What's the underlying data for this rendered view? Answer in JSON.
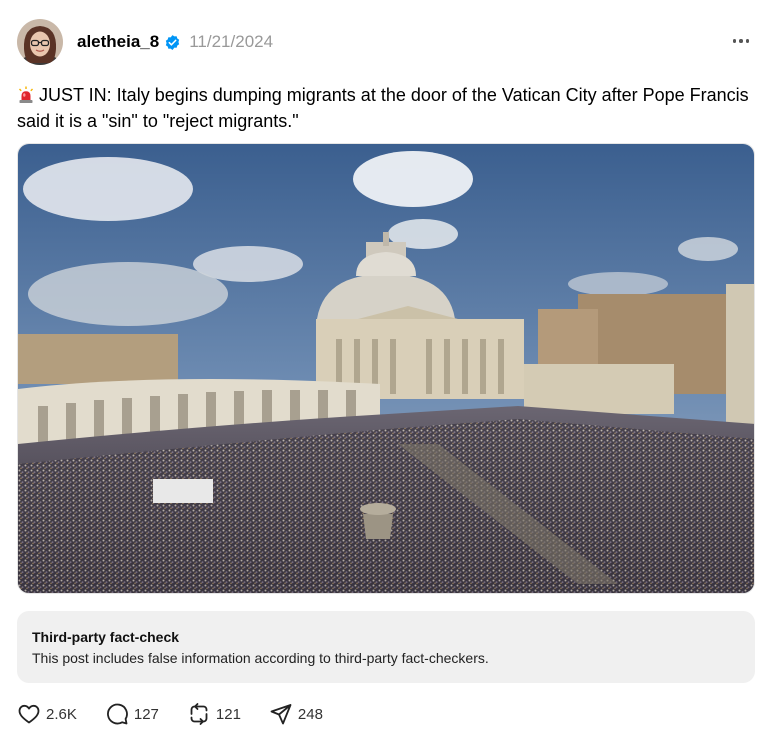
{
  "post": {
    "author": {
      "username": "aletheia_8",
      "avatar_icon": "profile-photo",
      "verified_icon": "verified-badge-icon",
      "verified_color": "#0095f6"
    },
    "timestamp": "11/21/2024",
    "more_icon": "more-horizontal-icon",
    "text_icon": "police-siren-icon",
    "text": "JUST IN: Italy begins dumping migrants at the door of the Vatican City after Pope Francis said it is a \"sin\" to \"reject migrants.\"",
    "image_icon": "st-peters-square-photo"
  },
  "fact_check": {
    "title": "Third-party fact-check",
    "body": "This post includes false information according to third-party fact-checkers.",
    "background": "#f0f0f0"
  },
  "actions": {
    "like": {
      "icon": "heart-icon",
      "count": "2.6K"
    },
    "reply": {
      "icon": "comment-icon",
      "count": "127"
    },
    "repost": {
      "icon": "repost-icon",
      "count": "121"
    },
    "share": {
      "icon": "send-icon",
      "count": "248"
    }
  }
}
